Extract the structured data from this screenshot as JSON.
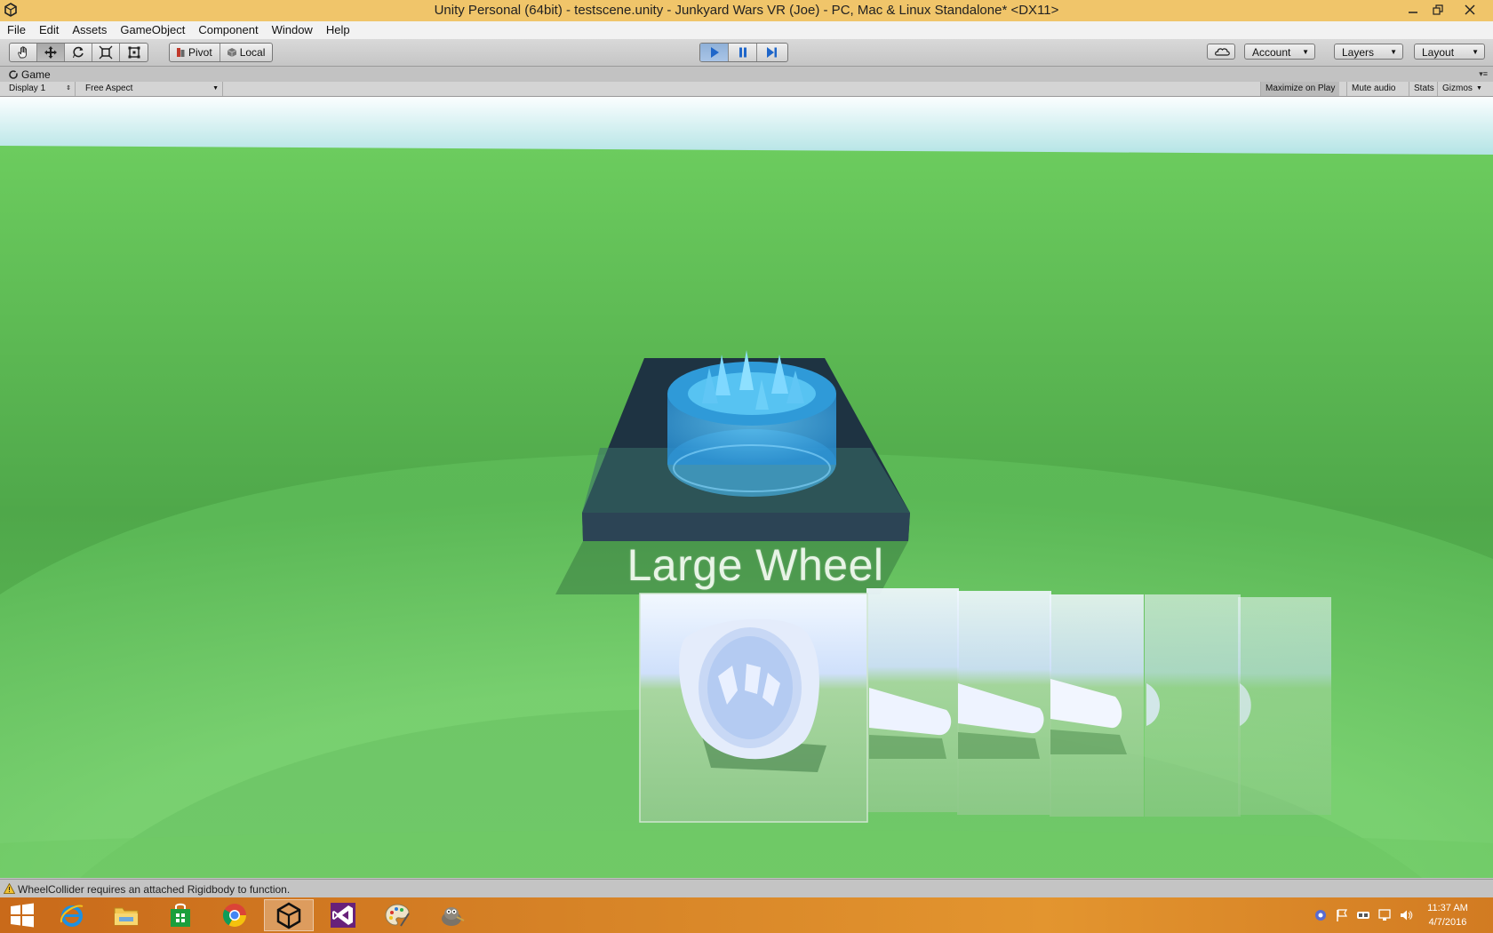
{
  "window": {
    "title": "Unity Personal (64bit) - testscene.unity - Junkyard Wars VR (Joe) - PC, Mac & Linux Standalone* <DX11>",
    "controls": [
      "minimize",
      "restore",
      "close"
    ]
  },
  "menu": {
    "items": [
      "File",
      "Edit",
      "Assets",
      "GameObject",
      "Component",
      "Window",
      "Help"
    ]
  },
  "toolbar": {
    "transform_tools": [
      "hand-tool",
      "move-tool",
      "rotate-tool",
      "scale-tool",
      "rect-tool"
    ],
    "active_tool": "move-tool",
    "pivot_label": "Pivot",
    "local_label": "Local",
    "playback": {
      "playing": true,
      "paused": false
    },
    "account_label": "Account",
    "layers_label": "Layers",
    "layout_label": "Layout"
  },
  "game_tab": {
    "label": "Game",
    "display_label": "Display 1",
    "aspect_label": "Free Aspect",
    "maximize_label": "Maximize on Play",
    "mute_label": "Mute audio",
    "stats_label": "Stats",
    "gizmos_label": "Gizmos"
  },
  "scene": {
    "item_label": "Large Wheel",
    "colors": {
      "sky_top": "#f4fbfd",
      "sky_bottom": "#a8dfe0",
      "ground": "#5cb85a",
      "hologram": "#3aa6e6",
      "panel_dark": "#1f3140"
    }
  },
  "status": {
    "message": "WheelCollider requires an attached Rigidbody to function."
  },
  "taskbar": {
    "apps": [
      "windows-start",
      "internet-explorer",
      "file-explorer",
      "store",
      "chrome",
      "unity",
      "visual-studio",
      "paint",
      "gimp"
    ],
    "active_app": "unity",
    "time": "11:37 AM",
    "date": "4/7/2016"
  }
}
